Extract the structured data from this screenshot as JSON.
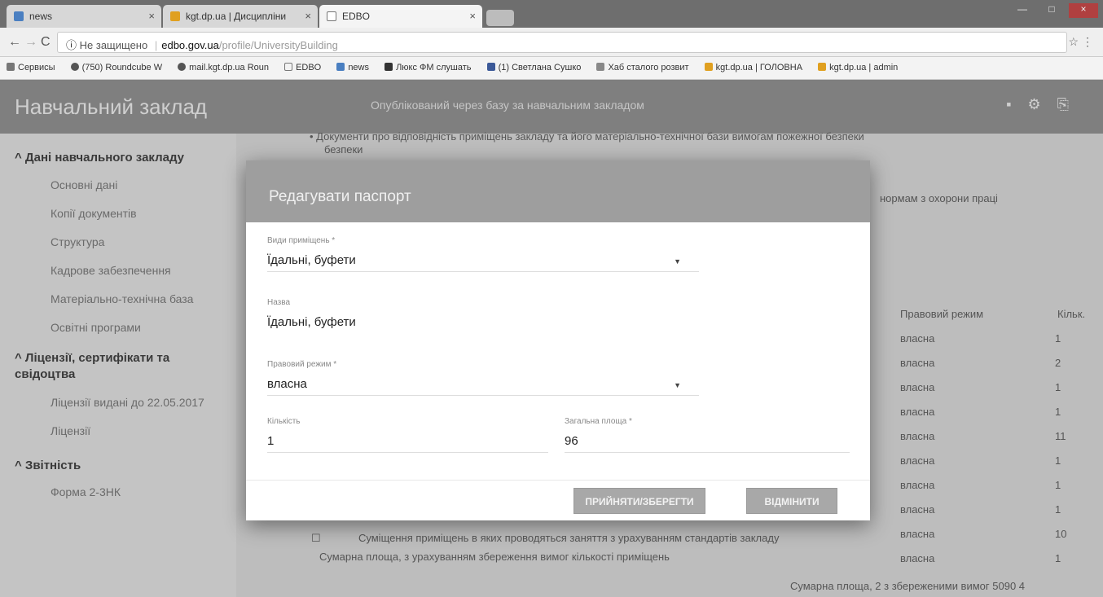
{
  "browser": {
    "tabs": [
      {
        "label": "news",
        "active": false
      },
      {
        "label": "kgt.dp.ua | Дисципліни",
        "active": false
      },
      {
        "label": "EDBO",
        "active": true
      }
    ],
    "address": {
      "insecure_label": "Не защищено",
      "domain": "edbo.gov.ua",
      "path": "/profile/UniversityBuilding"
    },
    "bookmarks": [
      "Сервисы",
      "(750) Roundcube W",
      "mail.kgt.dp.ua Roun",
      "EDBO",
      "news",
      "Люкс ФМ слушать",
      "(1) Светлана Сушко",
      "Хаб сталого розвит",
      "kgt.dp.ua | ГОЛОВНА",
      "kgt.dp.ua | admin"
    ]
  },
  "app": {
    "title": "Навчальний заклад",
    "header_message": "Опублікований через базу за навчальним закладом"
  },
  "sidebar": {
    "sections": [
      {
        "title": "^ Дані навчального закладу",
        "items": [
          "Основні дані",
          "Копії документів",
          "Структура",
          "Кадрове забезпечення",
          "Матеріально-технічна база",
          "Освітні програми"
        ]
      },
      {
        "title": "^ Ліцензії, сертифікати та свідоцтва",
        "items": [
          "Ліцензії видані до 22.05.2017",
          "Ліцензії"
        ]
      },
      {
        "title": "^ Звітність",
        "items": [
          "Форма 2-3НК"
        ]
      }
    ]
  },
  "content": {
    "line1": "• Документи про відповідність приміщень закладу та його матеріально-технічної бази вимогам пожежної безпеки",
    "line1b": "безпеки",
    "line2": "нормам з охорони праці",
    "right_header": "Правовий режим",
    "right_header2": "Кільк.",
    "right_rows": [
      "власна",
      "власна",
      "власна",
      "власна",
      "власна",
      "власна",
      "власна",
      "власна",
      "власна",
      "власна"
    ],
    "right_nums": [
      "1",
      "2",
      "1",
      "1",
      "11",
      "1",
      "1",
      "1",
      "10",
      "1"
    ],
    "bottom_text": "Суміщення приміщень в яких проводяться заняття з урахуванням стандартів закладу",
    "bottom_text2": "Сумарна площа, з урахуванням збереження вимог кількості приміщень",
    "sum_text": "Сумарна площа, 2 з збереженими вимог 5090 4"
  },
  "modal": {
    "title": "Редагувати паспорт",
    "fields": {
      "room_type": {
        "label": "Види приміщень *",
        "value": "Їдальні, буфети"
      },
      "name": {
        "label": "Назва",
        "value": "Їдальні, буфети"
      },
      "legal_regime": {
        "label": "Правовий режим *",
        "value": "власна"
      },
      "quantity": {
        "label": "Кількість",
        "value": "1"
      },
      "total_area": {
        "label": "Загальна площа *",
        "value": "96"
      }
    },
    "buttons": {
      "save": "ПРИЙНЯТИ/ЗБЕРЕГТИ",
      "cancel": "ВІДМІНИТИ"
    }
  },
  "colors": {
    "modal_header": "#9e9e9e",
    "button": "#a8a8a8",
    "overlay": "#bdbdbd"
  }
}
